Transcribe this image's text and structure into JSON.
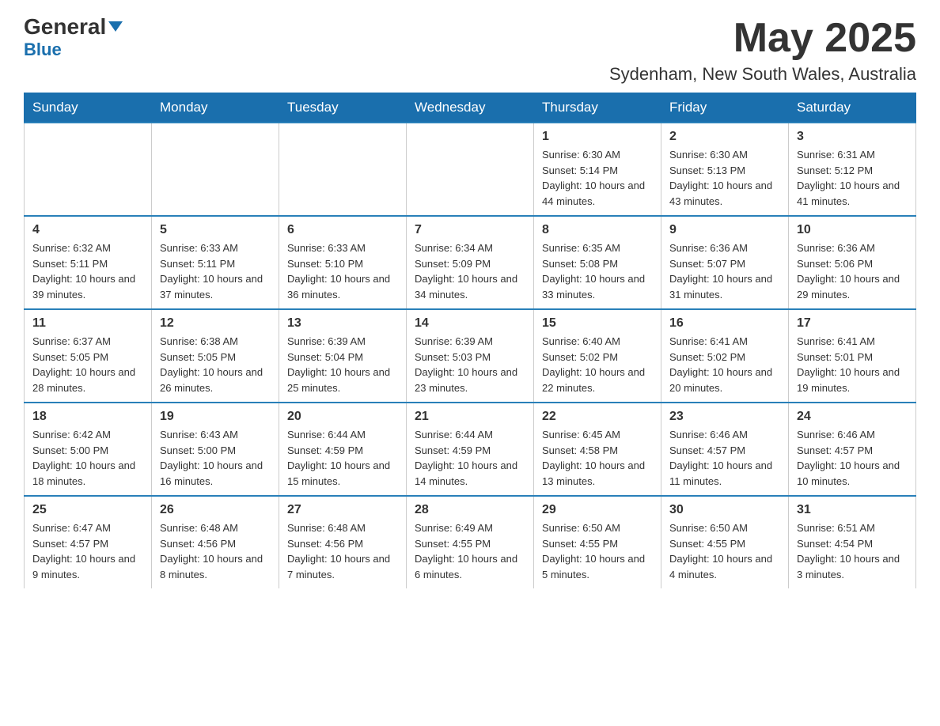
{
  "header": {
    "logo_general": "General",
    "logo_blue": "Blue",
    "month_title": "May 2025",
    "location": "Sydenham, New South Wales, Australia"
  },
  "days_of_week": [
    "Sunday",
    "Monday",
    "Tuesday",
    "Wednesday",
    "Thursday",
    "Friday",
    "Saturday"
  ],
  "weeks": [
    [
      {
        "day": "",
        "sunrise": "",
        "sunset": "",
        "daylight": ""
      },
      {
        "day": "",
        "sunrise": "",
        "sunset": "",
        "daylight": ""
      },
      {
        "day": "",
        "sunrise": "",
        "sunset": "",
        "daylight": ""
      },
      {
        "day": "",
        "sunrise": "",
        "sunset": "",
        "daylight": ""
      },
      {
        "day": "1",
        "sunrise": "Sunrise: 6:30 AM",
        "sunset": "Sunset: 5:14 PM",
        "daylight": "Daylight: 10 hours and 44 minutes."
      },
      {
        "day": "2",
        "sunrise": "Sunrise: 6:30 AM",
        "sunset": "Sunset: 5:13 PM",
        "daylight": "Daylight: 10 hours and 43 minutes."
      },
      {
        "day": "3",
        "sunrise": "Sunrise: 6:31 AM",
        "sunset": "Sunset: 5:12 PM",
        "daylight": "Daylight: 10 hours and 41 minutes."
      }
    ],
    [
      {
        "day": "4",
        "sunrise": "Sunrise: 6:32 AM",
        "sunset": "Sunset: 5:11 PM",
        "daylight": "Daylight: 10 hours and 39 minutes."
      },
      {
        "day": "5",
        "sunrise": "Sunrise: 6:33 AM",
        "sunset": "Sunset: 5:11 PM",
        "daylight": "Daylight: 10 hours and 37 minutes."
      },
      {
        "day": "6",
        "sunrise": "Sunrise: 6:33 AM",
        "sunset": "Sunset: 5:10 PM",
        "daylight": "Daylight: 10 hours and 36 minutes."
      },
      {
        "day": "7",
        "sunrise": "Sunrise: 6:34 AM",
        "sunset": "Sunset: 5:09 PM",
        "daylight": "Daylight: 10 hours and 34 minutes."
      },
      {
        "day": "8",
        "sunrise": "Sunrise: 6:35 AM",
        "sunset": "Sunset: 5:08 PM",
        "daylight": "Daylight: 10 hours and 33 minutes."
      },
      {
        "day": "9",
        "sunrise": "Sunrise: 6:36 AM",
        "sunset": "Sunset: 5:07 PM",
        "daylight": "Daylight: 10 hours and 31 minutes."
      },
      {
        "day": "10",
        "sunrise": "Sunrise: 6:36 AM",
        "sunset": "Sunset: 5:06 PM",
        "daylight": "Daylight: 10 hours and 29 minutes."
      }
    ],
    [
      {
        "day": "11",
        "sunrise": "Sunrise: 6:37 AM",
        "sunset": "Sunset: 5:05 PM",
        "daylight": "Daylight: 10 hours and 28 minutes."
      },
      {
        "day": "12",
        "sunrise": "Sunrise: 6:38 AM",
        "sunset": "Sunset: 5:05 PM",
        "daylight": "Daylight: 10 hours and 26 minutes."
      },
      {
        "day": "13",
        "sunrise": "Sunrise: 6:39 AM",
        "sunset": "Sunset: 5:04 PM",
        "daylight": "Daylight: 10 hours and 25 minutes."
      },
      {
        "day": "14",
        "sunrise": "Sunrise: 6:39 AM",
        "sunset": "Sunset: 5:03 PM",
        "daylight": "Daylight: 10 hours and 23 minutes."
      },
      {
        "day": "15",
        "sunrise": "Sunrise: 6:40 AM",
        "sunset": "Sunset: 5:02 PM",
        "daylight": "Daylight: 10 hours and 22 minutes."
      },
      {
        "day": "16",
        "sunrise": "Sunrise: 6:41 AM",
        "sunset": "Sunset: 5:02 PM",
        "daylight": "Daylight: 10 hours and 20 minutes."
      },
      {
        "day": "17",
        "sunrise": "Sunrise: 6:41 AM",
        "sunset": "Sunset: 5:01 PM",
        "daylight": "Daylight: 10 hours and 19 minutes."
      }
    ],
    [
      {
        "day": "18",
        "sunrise": "Sunrise: 6:42 AM",
        "sunset": "Sunset: 5:00 PM",
        "daylight": "Daylight: 10 hours and 18 minutes."
      },
      {
        "day": "19",
        "sunrise": "Sunrise: 6:43 AM",
        "sunset": "Sunset: 5:00 PM",
        "daylight": "Daylight: 10 hours and 16 minutes."
      },
      {
        "day": "20",
        "sunrise": "Sunrise: 6:44 AM",
        "sunset": "Sunset: 4:59 PM",
        "daylight": "Daylight: 10 hours and 15 minutes."
      },
      {
        "day": "21",
        "sunrise": "Sunrise: 6:44 AM",
        "sunset": "Sunset: 4:59 PM",
        "daylight": "Daylight: 10 hours and 14 minutes."
      },
      {
        "day": "22",
        "sunrise": "Sunrise: 6:45 AM",
        "sunset": "Sunset: 4:58 PM",
        "daylight": "Daylight: 10 hours and 13 minutes."
      },
      {
        "day": "23",
        "sunrise": "Sunrise: 6:46 AM",
        "sunset": "Sunset: 4:57 PM",
        "daylight": "Daylight: 10 hours and 11 minutes."
      },
      {
        "day": "24",
        "sunrise": "Sunrise: 6:46 AM",
        "sunset": "Sunset: 4:57 PM",
        "daylight": "Daylight: 10 hours and 10 minutes."
      }
    ],
    [
      {
        "day": "25",
        "sunrise": "Sunrise: 6:47 AM",
        "sunset": "Sunset: 4:57 PM",
        "daylight": "Daylight: 10 hours and 9 minutes."
      },
      {
        "day": "26",
        "sunrise": "Sunrise: 6:48 AM",
        "sunset": "Sunset: 4:56 PM",
        "daylight": "Daylight: 10 hours and 8 minutes."
      },
      {
        "day": "27",
        "sunrise": "Sunrise: 6:48 AM",
        "sunset": "Sunset: 4:56 PM",
        "daylight": "Daylight: 10 hours and 7 minutes."
      },
      {
        "day": "28",
        "sunrise": "Sunrise: 6:49 AM",
        "sunset": "Sunset: 4:55 PM",
        "daylight": "Daylight: 10 hours and 6 minutes."
      },
      {
        "day": "29",
        "sunrise": "Sunrise: 6:50 AM",
        "sunset": "Sunset: 4:55 PM",
        "daylight": "Daylight: 10 hours and 5 minutes."
      },
      {
        "day": "30",
        "sunrise": "Sunrise: 6:50 AM",
        "sunset": "Sunset: 4:55 PM",
        "daylight": "Daylight: 10 hours and 4 minutes."
      },
      {
        "day": "31",
        "sunrise": "Sunrise: 6:51 AM",
        "sunset": "Sunset: 4:54 PM",
        "daylight": "Daylight: 10 hours and 3 minutes."
      }
    ]
  ]
}
